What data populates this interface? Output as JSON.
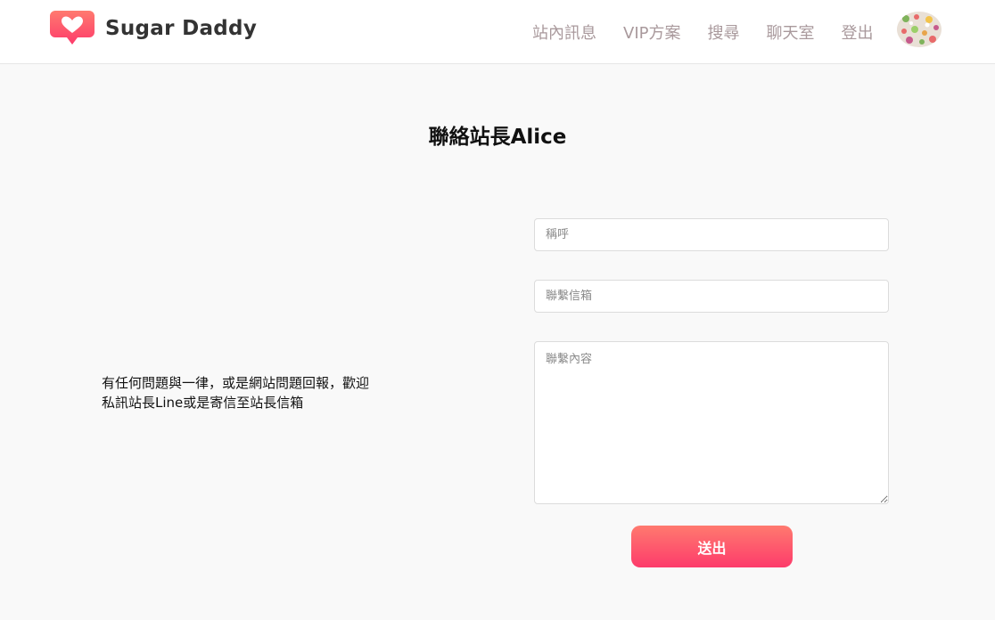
{
  "header": {
    "brand": "Sugar Daddy",
    "nav": [
      {
        "label": "站內訊息"
      },
      {
        "label": "VIP方案"
      },
      {
        "label": "搜尋"
      },
      {
        "label": "聊天室"
      },
      {
        "label": "登出"
      }
    ],
    "avatar_icon": "user-avatar"
  },
  "main": {
    "title": "聯絡站長Alice",
    "intro_line1": "有任何問題與一律，或是網站問題回報，歡迎",
    "intro_line2": "私訊站長Line或是寄信至站長信箱",
    "form": {
      "name_placeholder": "稱呼",
      "email_placeholder": "聯繫信箱",
      "message_placeholder": "聯繫內容",
      "submit_label": "送出"
    }
  },
  "colors": {
    "accent_start": "#ff7a6f",
    "accent_end": "#fd3b6b",
    "nav_text": "#a9999c",
    "background": "#f9f9f9"
  }
}
